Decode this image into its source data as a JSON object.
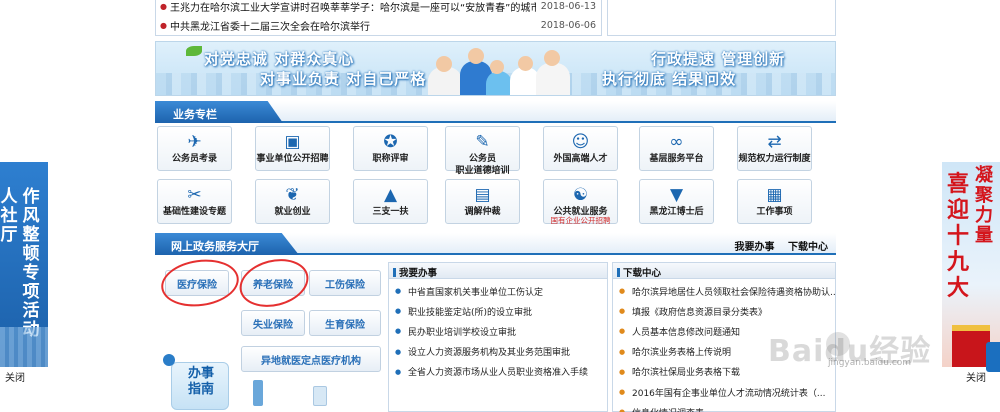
{
  "news": [
    {
      "title": "王兆力在哈尔滨工业大学宣讲时召唤莘莘学子：哈尔滨是一座可以“安放青春”的城市",
      "date": "2018-06-13"
    },
    {
      "title": "中共黑龙江省委十二届三次全会在哈尔滨举行",
      "date": "2018-06-06"
    }
  ],
  "banner": {
    "left_line1": "对党忠诚 对群众真心",
    "left_line2": "对事业负责 对自己严格",
    "right_line1": "行政提速 管理创新",
    "right_line2": "执行彻底 结果问效"
  },
  "business_section": {
    "title": "业务专栏",
    "tiles": [
      {
        "label": "公务员考录",
        "sub": "",
        "icon": "plane-icon"
      },
      {
        "label": "事业单位公开招聘",
        "sub": "",
        "icon": "id-card-icon"
      },
      {
        "label": "职称评审",
        "sub": "",
        "icon": "award-icon"
      },
      {
        "label": "公务员\n职业道德培训",
        "sub": "",
        "icon": "pen-icon"
      },
      {
        "label": "外国高端人才",
        "sub": "",
        "icon": "person-check-icon"
      },
      {
        "label": "基层服务平台",
        "sub": "",
        "icon": "link-icon"
      },
      {
        "label": "规范权力运行制度",
        "sub": "",
        "icon": "arrows-icon"
      },
      {
        "label": "基础性建设专题",
        "sub": "",
        "icon": "tools-icon"
      },
      {
        "label": "就业创业",
        "sub": "",
        "icon": "leaf-icon"
      },
      {
        "label": "三支一扶",
        "sub": "",
        "icon": "tent-icon"
      },
      {
        "label": "调解仲裁",
        "sub": "",
        "icon": "book-icon"
      },
      {
        "label": "公共就业服务",
        "sub": "国有企业公开招聘",
        "icon": "handshake-icon"
      },
      {
        "label": "黑龙江博士后",
        "sub": "",
        "icon": "graduate-icon"
      },
      {
        "label": "工作事项",
        "sub": "",
        "icon": "cabinet-icon"
      }
    ]
  },
  "hall": {
    "title": "网上政务服务大厅",
    "link_work": "我要办事",
    "link_download": "下载中心",
    "buttons": {
      "medical": "医疗保险",
      "pension": "养老保险",
      "injury": "工伤保险",
      "unemployment": "失业保险",
      "maternity": "生育保险",
      "remote_medical": "异地就医定点医疗机构"
    },
    "guide_text": "办事指南",
    "work_panel": {
      "title": "我要办事",
      "items": [
        "中省直国家机关事业单位工伤认定",
        "职业技能鉴定站(所)的设立审批",
        "民办职业培训学校设立审批",
        "设立人力资源服务机构及其业务范围审批",
        "全省人力资源市场从业人员职业资格准入手续"
      ]
    },
    "download_panel": {
      "title": "下载中心",
      "items": [
        "哈尔滨异地居住人员领取社会保险待遇资格协助认...",
        "填报《政府信息资源目录分类表》",
        "人员基本信息修改问题通知",
        "哈尔滨业务表格上传说明",
        "哈尔滨社保局业务表格下载",
        "2016年国有企事业单位人才流动情况统计表（...",
        "信息化情况调查表"
      ]
    }
  },
  "left_ad": {
    "col1": "人社厅",
    "col2": "作风整顿专项活动"
  },
  "right_ad": {
    "col1": "喜迎十九大",
    "col2": "凝聚力量"
  },
  "close_label": "关闭",
  "watermark": {
    "brand": "Baidu经验",
    "url": "jingyan.baidu.com"
  },
  "colors": {
    "accent": "#1f6fb8",
    "highlight_circle": "#e53030",
    "bullet_news": "#c0232a"
  }
}
